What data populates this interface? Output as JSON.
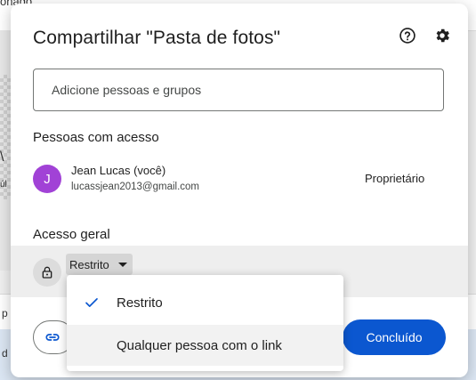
{
  "background": {
    "top_fragment": "onado",
    "left_fragment_1": "\\",
    "left_fragment_2": "úl",
    "left_fragment_3": "p",
    "left_fragment_4": "d"
  },
  "dialog": {
    "title": "Compartilhar \"Pasta de fotos\"",
    "help_icon": "help-circle-icon",
    "settings_icon": "gear-icon",
    "add_people_placeholder": "Adicione pessoas e grupos",
    "people_section_title": "Pessoas com acesso",
    "person": {
      "initial": "J",
      "name": "Jean Lucas (você)",
      "email": "lucassjean2013@gmail.com",
      "role": "Proprietário",
      "avatar_color": "#a142d6"
    },
    "general_access_title": "Acesso geral",
    "access_value": "Restrito",
    "copy_link_icon": "link-icon",
    "done_label": "Concluído",
    "accent_color": "#0b57d0"
  },
  "menu": {
    "items": [
      {
        "label": "Restrito",
        "selected": true
      },
      {
        "label": "Qualquer pessoa com o link",
        "selected": false
      }
    ]
  }
}
